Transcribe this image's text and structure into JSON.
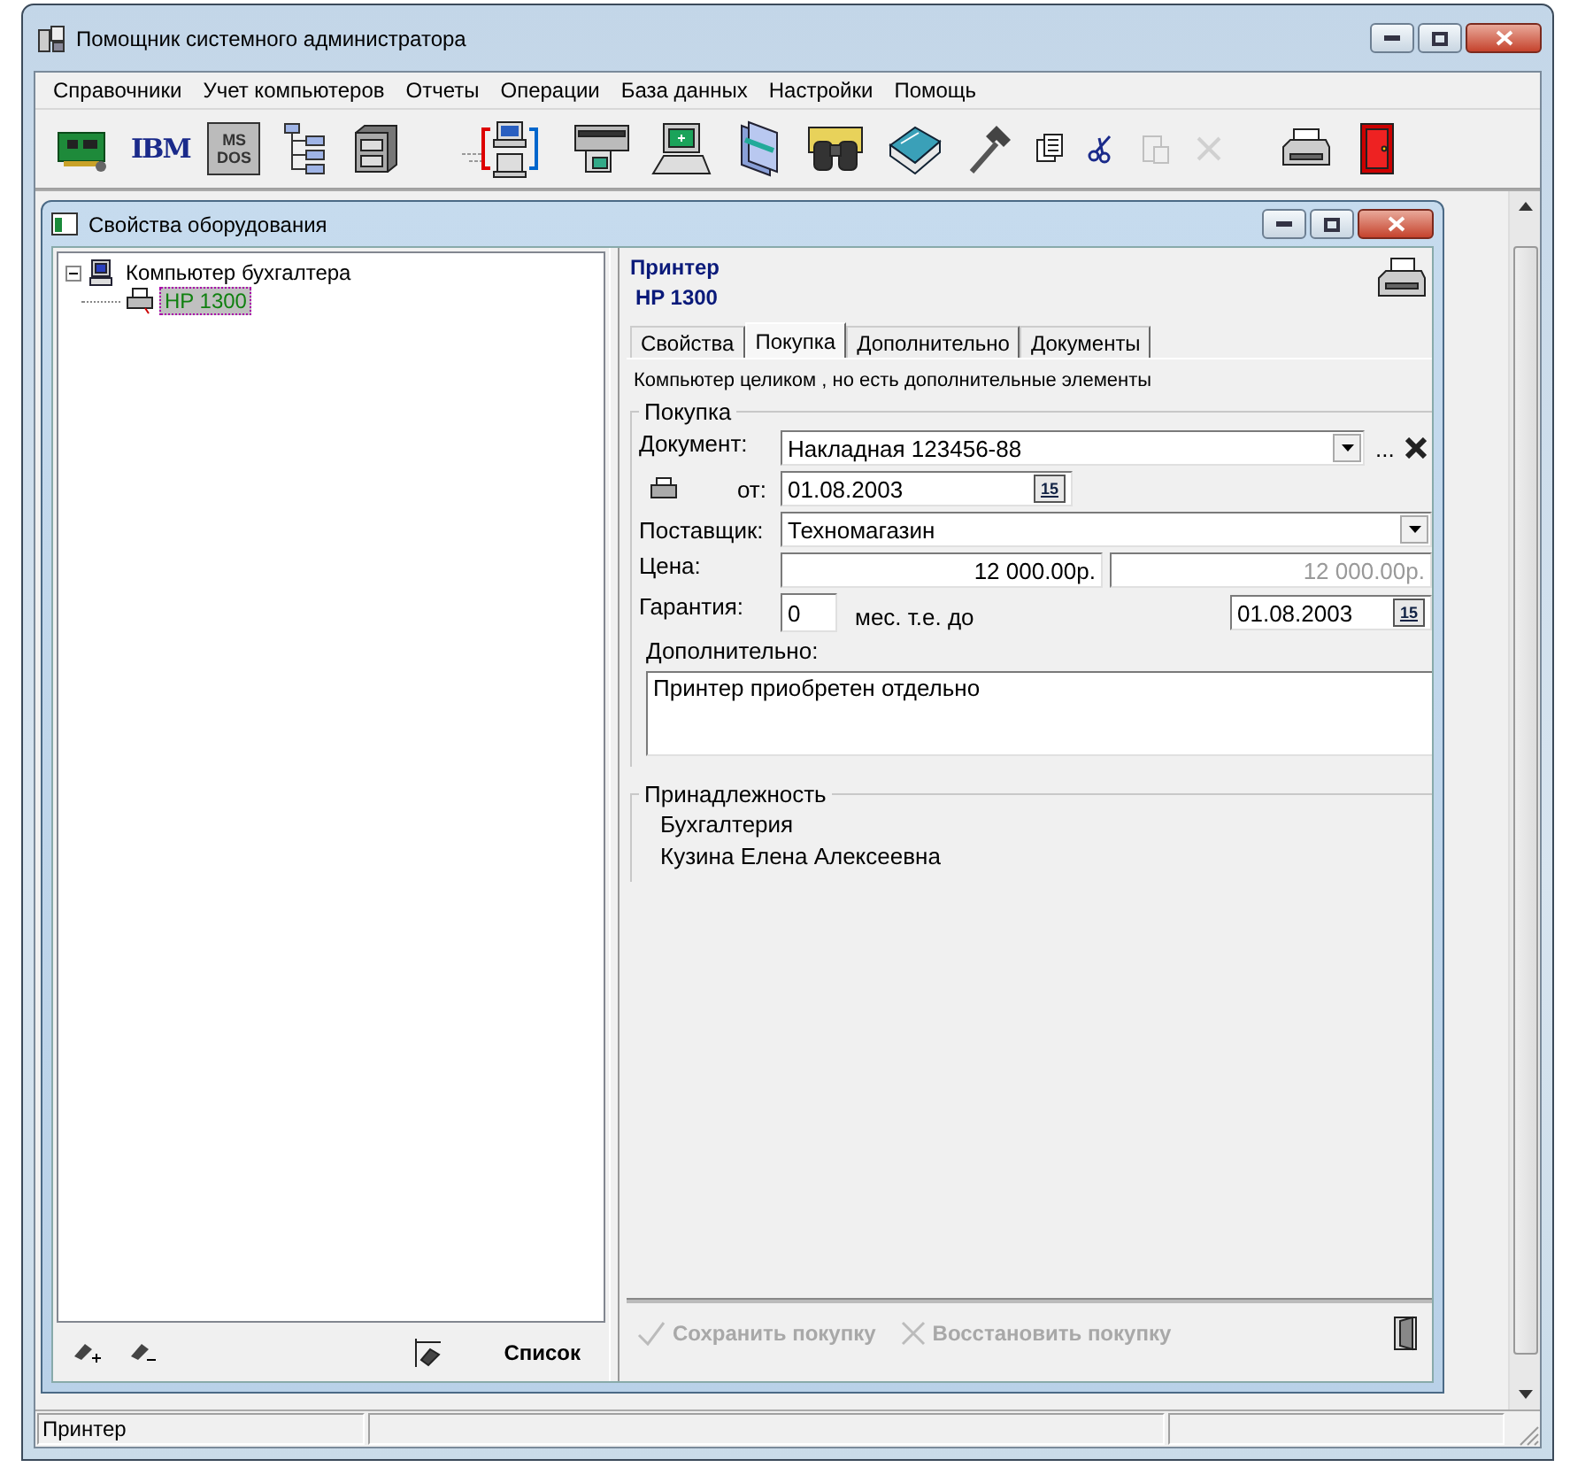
{
  "window": {
    "title": "Помощник системного администратора"
  },
  "menu": [
    {
      "label": "Справочники"
    },
    {
      "label": "Учет компьютеров"
    },
    {
      "label": "Отчеты"
    },
    {
      "label": "Операции"
    },
    {
      "label": "База данных"
    },
    {
      "label": "Настройки"
    },
    {
      "label": "Помощь"
    }
  ],
  "toolbar": [
    {
      "kind": "board"
    },
    {
      "kind": "logo",
      "label": "IBM"
    },
    {
      "kind": "chip",
      "label": "MS DOS"
    },
    {
      "kind": "tree"
    },
    {
      "kind": "cabinet"
    },
    {
      "kind": "gap"
    },
    {
      "kind": "network"
    },
    {
      "kind": "scanner"
    },
    {
      "kind": "computer"
    },
    {
      "kind": "folder"
    },
    {
      "kind": "binoculars"
    },
    {
      "kind": "book"
    },
    {
      "kind": "hammer"
    },
    {
      "kind": "copy",
      "disabled": false
    },
    {
      "kind": "cut",
      "disabled": false
    },
    {
      "kind": "paste",
      "disabled": true
    },
    {
      "kind": "delete",
      "disabled": true
    },
    {
      "kind": "gap"
    },
    {
      "kind": "printer"
    },
    {
      "kind": "door"
    }
  ],
  "child_window": {
    "title": "Свойства оборудования",
    "tree": [
      {
        "label": "Компьютер бухгалтера",
        "expanded": true,
        "selected": false,
        "children": [
          {
            "label": "HP 1300",
            "selected": true
          }
        ]
      }
    ],
    "list_button": "Список"
  },
  "details": {
    "type": "Принтер",
    "name": "HP 1300",
    "tabs": [
      {
        "label": "Свойства",
        "selected": false
      },
      {
        "label": "Покупка",
        "selected": true
      },
      {
        "label": "Дополнительно",
        "selected": false
      },
      {
        "label": "Документы",
        "selected": false
      }
    ],
    "note": "Компьютер целиком  , но есть дополнительные элементы",
    "purchase": {
      "legend": "Покупка",
      "document_label": "Документ:",
      "document": "Накладная 123456-88",
      "more_button": "...",
      "date_label": "от:",
      "date": "01.08.2003",
      "calendar_button": "15",
      "supplier_label": "Поставщик:",
      "supplier": "Техномагазин",
      "price_label": "Цена:",
      "prices": [
        {
          "value": "12 000.00р.",
          "disabled": false
        },
        {
          "value": "12 000.00р.",
          "disabled": true
        }
      ],
      "warranty_label": "Гарантия:",
      "warranty": "0",
      "warranty_unit": "мес. т.е. до",
      "warranty_date": "01.08.2003",
      "warranty_calendar_button": "15",
      "extra_label": "Дополнительно:",
      "extra": "Принтер приобретен отдельно"
    },
    "ownership": {
      "legend": "Принадлежность",
      "department": "Бухгалтерия",
      "person": "Кузина Елена Алексеевна"
    },
    "actions": [
      {
        "kind": "save",
        "label": "Сохранить покупку",
        "disabled": true
      },
      {
        "kind": "restore",
        "label": "Восстановить покупку",
        "disabled": true
      }
    ]
  },
  "status_bar": [
    {
      "text": "Принтер"
    }
  ]
}
